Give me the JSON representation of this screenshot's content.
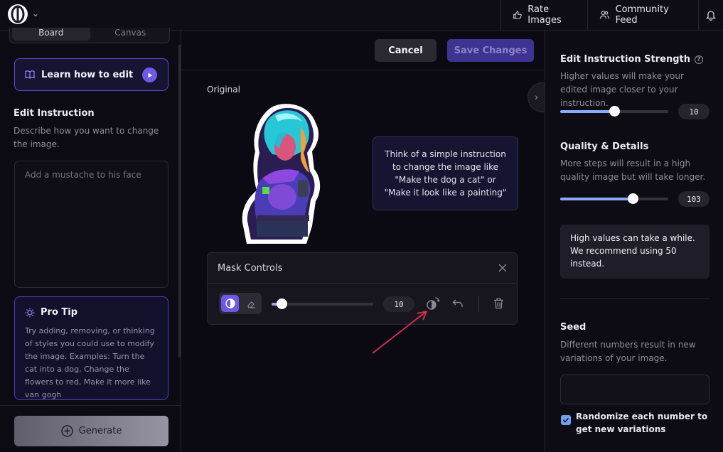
{
  "topbar": {
    "rate_label": "Rate Images",
    "community_label": "Community Feed"
  },
  "left": {
    "tabs": [
      "Board",
      "Canvas"
    ],
    "learn_label": "Learn how to edit",
    "instruction_heading": "Edit Instruction",
    "instruction_desc": "Describe how you want to change the image.",
    "instruction_placeholder": "Add a mustache to his face",
    "protip_heading": "Pro Tip",
    "protip_text": "Try adding, removing, or thinking of styles you could use to modify the image. Examples: Turn the cat into a dog, Change the flowers to red, Make it more like van gogh",
    "generate_label": "Generate"
  },
  "center": {
    "cancel_label": "Cancel",
    "save_label": "Save Changes",
    "original_label": "Original",
    "hint_text": "Think of a simple instruction to change the image like \"Make the dog a cat\" or \"Make it look like a painting\"",
    "mask": {
      "title": "Mask Controls",
      "brush_value": "10",
      "brush_fraction": 0.1
    }
  },
  "right": {
    "strength_heading": "Edit Instruction Strength",
    "strength_desc": "Higher values will make your edited image closer to your instruction.",
    "strength_value": "10",
    "strength_fraction": 0.5,
    "quality_heading": "Quality & Details",
    "quality_desc": "More steps will result in a high quality image but will take longer.",
    "quality_value": "103",
    "quality_fraction": 0.67,
    "quality_warning": "High values can take a while. We recommend using 50 instead.",
    "seed_heading": "Seed",
    "seed_desc": "Different numbers result in new variations of your image.",
    "randomize_label": "Randomize each number to get new variations",
    "randomize_checked": true
  },
  "colors": {
    "accent": "#6b59e6",
    "slider_fill": "#8aa9f6",
    "annotation_arrow": "#d9304a"
  }
}
